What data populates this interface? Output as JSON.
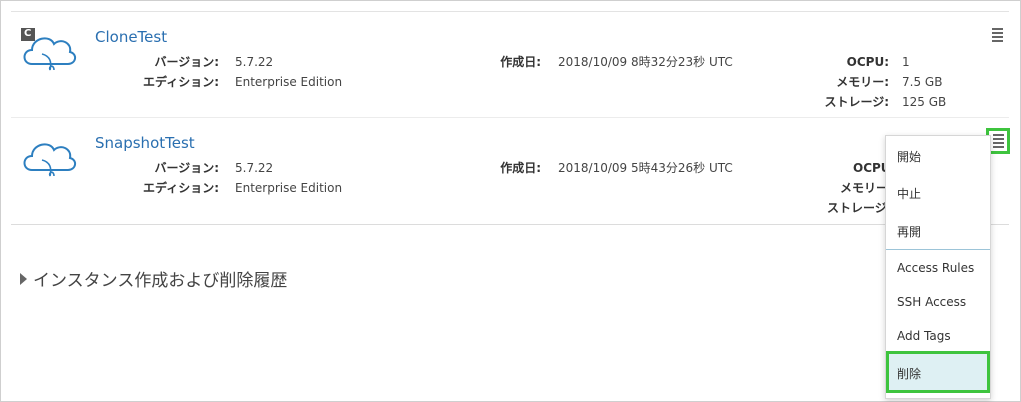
{
  "instances": [
    {
      "name": "CloneTest",
      "version_label": "バージョン:",
      "version": "5.7.22",
      "edition_label": "エディション:",
      "edition": "Enterprise Edition",
      "created_label": "作成日:",
      "created": "2018/10/09 8時32分23秒 UTC",
      "ocpu_label": "OCPU:",
      "ocpu": "1",
      "memory_label": "メモリー:",
      "memory": "7.5 GB",
      "storage_label": "ストレージ:",
      "storage": "125 GB",
      "badge": "C"
    },
    {
      "name": "SnapshotTest",
      "version_label": "バージョン:",
      "version": "5.7.22",
      "edition_label": "エディション:",
      "edition": "Enterprise Edition",
      "created_label": "作成日:",
      "created": "2018/10/09 5時43分26秒 UTC",
      "ocpu_label": "OCPU",
      "memory_label": "メモリー",
      "storage_label": "ストレージ"
    }
  ],
  "history": {
    "title": "インスタンス作成および削除履歴"
  },
  "menu": {
    "items": [
      "開始",
      "中止",
      "再開",
      "Access Rules",
      "SSH Access",
      "Add Tags",
      "削除"
    ]
  },
  "colors": {
    "link": "#2a6fb0",
    "highlight": "#3ec43e",
    "selected_bg": "#def0f3"
  },
  "icons": {
    "instance": "mysql-cloud-icon",
    "menu": "hamburger-menu-icon"
  }
}
